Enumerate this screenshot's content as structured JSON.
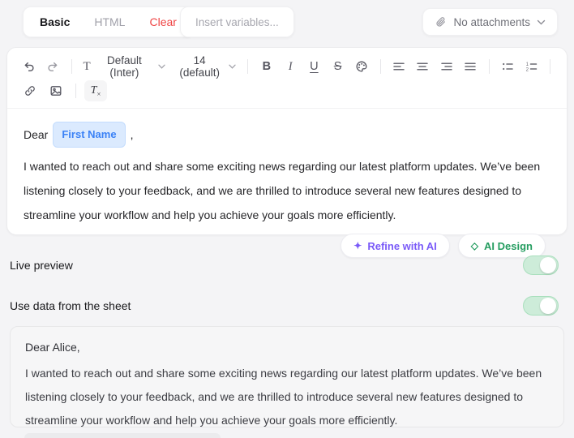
{
  "colors": {
    "page_bg": "#f4f4f6",
    "accent_blue": "#3b82f6",
    "chip_bg": "#dbeafe",
    "danger_red": "#ef4444",
    "ai_purple": "#7a5af8",
    "ai_green": "#259d60",
    "toggle_on_green": "#cdecd9"
  },
  "top_bar": {
    "tabs": [
      {
        "label": "Basic",
        "state": "active"
      },
      {
        "label": "HTML",
        "state": "inactive"
      },
      {
        "label": "Clear",
        "state": "danger"
      }
    ],
    "insert_variables": "Insert variables...",
    "attachments": "No attachments"
  },
  "toolbar": {
    "font_label": "Default (Inter)",
    "size_label": "14 (default)",
    "glyphs": {
      "text_style": "T",
      "bold": "B",
      "italic": "I",
      "underline": "U",
      "strike": "S",
      "clear_t": "T",
      "clear_x": "×"
    }
  },
  "editor": {
    "salutation_prefix": "Dear",
    "variable_chip": "First Name",
    "salutation_suffix": ",",
    "body": "I wanted to reach out and share some exciting news regarding our latest platform updates. We’ve been listening closely to your feedback, and we are thrilled to introduce several new features designed to streamline your workflow and help you achieve your goals more efficiently.",
    "refine_button": {
      "icon": "✦",
      "label": "Refine with AI"
    },
    "design_button": {
      "icon": "◇",
      "label": "AI Design"
    }
  },
  "settings": [
    {
      "label": "Live preview",
      "enabled": true
    },
    {
      "label": "Use data from the sheet",
      "enabled": true
    }
  ],
  "preview": {
    "salutation": "Dear Alice,",
    "body": "I wanted to reach out and share some exciting news regarding our latest platform updates. We’ve been listening closely to your feedback, and we are thrilled to introduce several new features designed to streamline your workflow and help you achieve your goals more efficiently."
  }
}
